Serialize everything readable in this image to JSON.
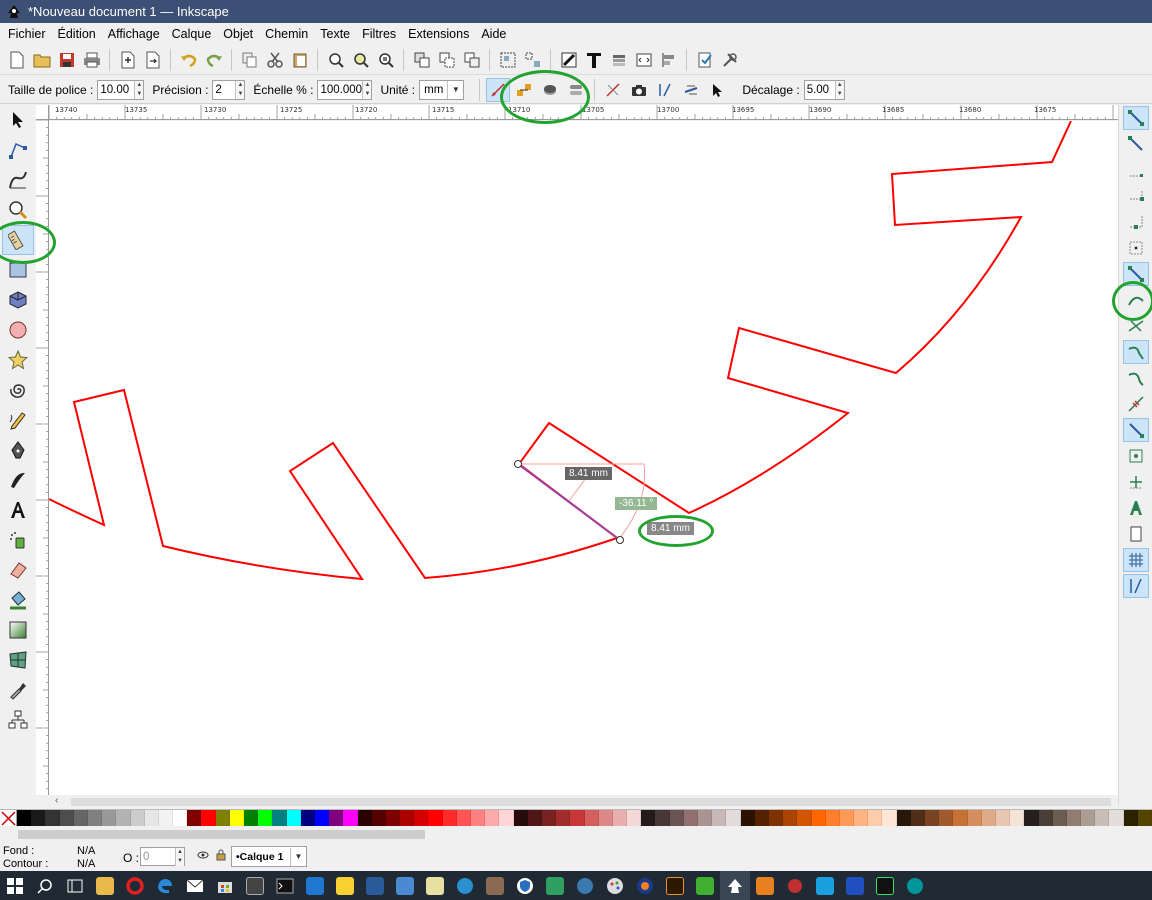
{
  "window": {
    "title": "*Nouveau document 1 — Inkscape"
  },
  "menu": [
    "Fichier",
    "Édition",
    "Affichage",
    "Calque",
    "Objet",
    "Chemin",
    "Texte",
    "Filtres",
    "Extensions",
    "Aide"
  ],
  "tool_controls": {
    "font_size_label": "Taille de police :",
    "font_size_value": "10.00",
    "precision_label": "Précision :",
    "precision_value": "2",
    "scale_label": "Échelle % :",
    "scale_value": "100.000",
    "unit_label": "Unité :",
    "unit_value": "mm",
    "offset_label": "Décalage :",
    "offset_value": "5.00"
  },
  "ruler": {
    "top_labels": [
      "13740",
      "13735",
      "13730",
      "13725",
      "13720",
      "13715",
      "13710",
      "13705",
      "13700",
      "13695",
      "13690",
      "13685",
      "13680",
      "13675"
    ]
  },
  "measure": {
    "length_1": "8.41 mm",
    "angle": "-36.11 °",
    "length_2": "8.41 mm"
  },
  "colors": {
    "path_stroke": "#ff0000",
    "measure_line": "#a040a0",
    "highlight": "#22a32f",
    "titlebar": "#3c4f75"
  },
  "palette": [
    "#000000",
    "#1a1a1a",
    "#333333",
    "#4d4d4d",
    "#666666",
    "#808080",
    "#999999",
    "#b3b3b3",
    "#cccccc",
    "#e6e6e6",
    "#f2f2f2",
    "#ffffff",
    "#800000",
    "#ff0000",
    "#808000",
    "#ffff00",
    "#008000",
    "#00ff00",
    "#008080",
    "#00ffff",
    "#000080",
    "#0000ff",
    "#800080",
    "#ff00ff",
    "#2b0000",
    "#550000",
    "#800000",
    "#aa0000",
    "#d40000",
    "#ff0000",
    "#ff2a2a",
    "#ff5555",
    "#ff8080",
    "#ffaaaa",
    "#ffd5d5",
    "#280b0b",
    "#501616",
    "#782121",
    "#a02c2c",
    "#c83737",
    "#d35f5f",
    "#de8787",
    "#e9afaf",
    "#f4d7d7",
    "#241c1c",
    "#483737",
    "#6c5353",
    "#916f6f",
    "#ac9393",
    "#c8b7b7",
    "#e3dbdb",
    "#2b1100",
    "#552200",
    "#803300",
    "#aa4400",
    "#d45500",
    "#ff6600",
    "#ff7f2a",
    "#ff9955",
    "#ffb380",
    "#ffccaa",
    "#ffe6d5",
    "#28170b",
    "#502d16",
    "#784421",
    "#a05a2c",
    "#c87137",
    "#d38d5f",
    "#deaa87",
    "#e9c6af",
    "#f4e3d7",
    "#241f1c",
    "#483e37",
    "#6c5d53",
    "#917c6f",
    "#ac9d93",
    "#c8beb7",
    "#e3dedb",
    "#2b2200",
    "#554400"
  ],
  "status": {
    "fill_label": "Fond :",
    "fill_value": "N/A",
    "stroke_label": "Contour :",
    "stroke_value": "N/A",
    "opacity_label": "O :",
    "opacity_value": "0",
    "layer_value": "•Calque 1"
  }
}
